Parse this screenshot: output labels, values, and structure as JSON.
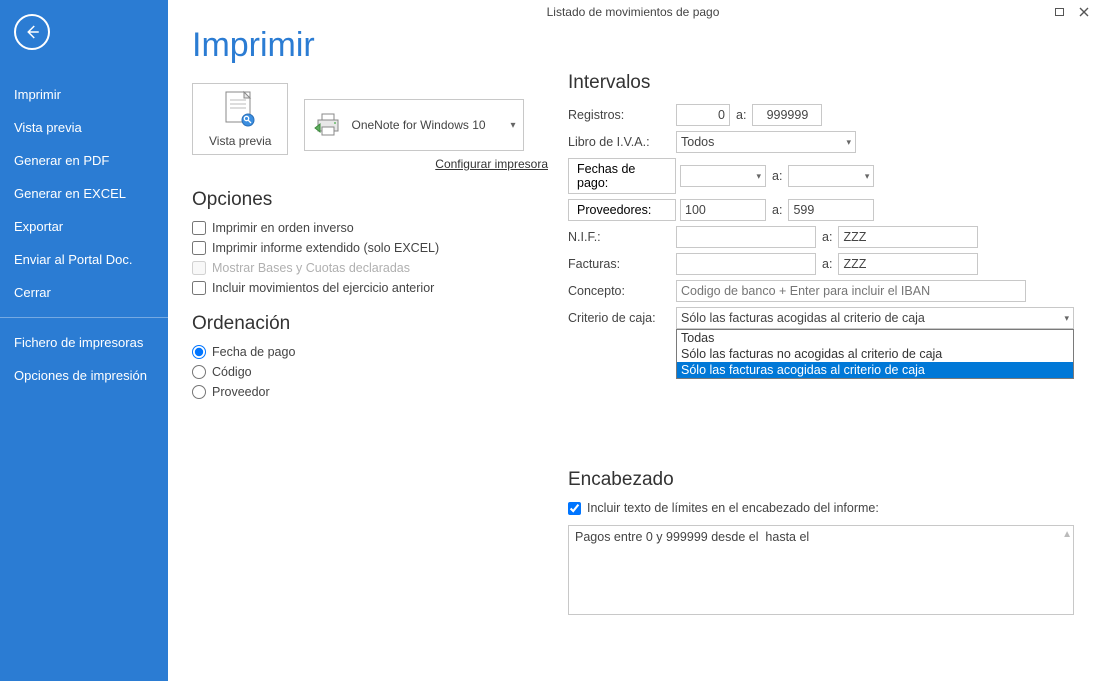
{
  "window_title": "Listado de movimientos de pago",
  "page_heading": "Imprimir",
  "sidebar": {
    "items": [
      "Imprimir",
      "Vista previa",
      "Generar en PDF",
      "Generar en EXCEL",
      "Exportar",
      "Enviar al Portal Doc.",
      "Cerrar"
    ],
    "items2": [
      "Fichero de impresoras",
      "Opciones de impresión"
    ]
  },
  "preview_label": "Vista previa",
  "printer_name": "OneNote for Windows 10",
  "configure_printer": "Configurar impresora",
  "opciones": {
    "heading": "Opciones",
    "inverse": "Imprimir en orden inverso",
    "extended": "Imprimir informe extendido (solo EXCEL)",
    "bases": "Mostrar Bases y Cuotas declaradas",
    "prev_ex": "Incluir movimientos del ejercicio anterior"
  },
  "orden": {
    "heading": "Ordenación",
    "fecha": "Fecha de pago",
    "codigo": "Código",
    "prov": "Proveedor"
  },
  "intervalos": {
    "heading": "Intervalos",
    "registros_lab": "Registros:",
    "registros_from": "0",
    "registros_to": "999999",
    "a": "a:",
    "libro_lab": "Libro de I.V.A.:",
    "libro_val": "Todos",
    "fechas_lab": "Fechas de pago:",
    "fechas_from": "",
    "fechas_to": "",
    "prov_lab": "Proveedores:",
    "prov_from": "100",
    "prov_to": "599",
    "nif_lab": "N.I.F.:",
    "nif_from": "",
    "nif_to": "ZZZ",
    "fact_lab": "Facturas:",
    "fact_from": "",
    "fact_to": "ZZZ",
    "concepto_lab": "Concepto:",
    "concepto_ph": "Codigo de banco + Enter para incluir el IBAN",
    "criterio_lab": "Criterio de caja:",
    "criterio_val": "Sólo las facturas acogidas al criterio de caja",
    "criterio_opts": [
      "Todas",
      "Sólo las facturas no acogidas al criterio de caja",
      "Sólo las facturas acogidas al criterio de caja"
    ]
  },
  "encabezado": {
    "heading": "Encabezado",
    "check": "Incluir texto de límites en el encabezado del informe:",
    "text": "Pagos entre 0 y 999999 desde el  hasta el "
  }
}
